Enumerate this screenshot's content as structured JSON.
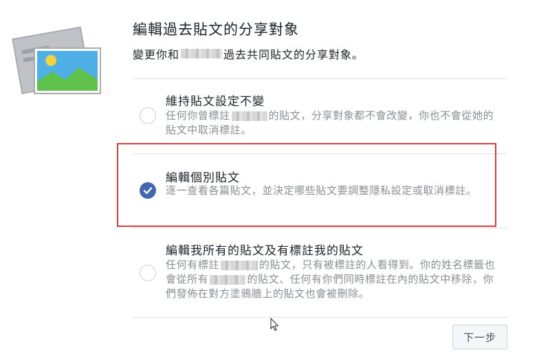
{
  "dialog": {
    "title": "編輯過去貼文的分享對象",
    "subtitle_prefix": "變更你和",
    "subtitle_suffix": "過去共同貼文的分享對象。"
  },
  "options": [
    {
      "title": "維持貼文設定不變",
      "desc_part1": "任何你曾標註",
      "desc_part2": "的貼文，分享對象都不會改變，你也不會從她的貼文中取消標註。",
      "selected": false
    },
    {
      "title": "編輯個別貼文",
      "desc": "逐一查看各篇貼文，並決定哪些貼文要調整隱私設定或取消標註。",
      "selected": true
    },
    {
      "title": "編輯我所有的貼文及有標註我的貼文",
      "desc_part1": "任何有標註",
      "desc_part2": "的貼文，只有被標註的人看得到。你的姓名標籤也會從所有",
      "desc_part3": "的貼文、任何有你們同時標註在內的貼文中移除，你們發佈在對方塗鴉牆上的貼文也會被刪除。",
      "selected": false
    }
  ],
  "footer": {
    "next_label": "下一步"
  },
  "colors": {
    "accent": "#4267b2",
    "highlight_border": "#dc3c3c"
  },
  "icons": {
    "illustration": "photo-album-icon",
    "radio_checked": "checkmark-icon",
    "cursor": "mouse-pointer-icon"
  }
}
